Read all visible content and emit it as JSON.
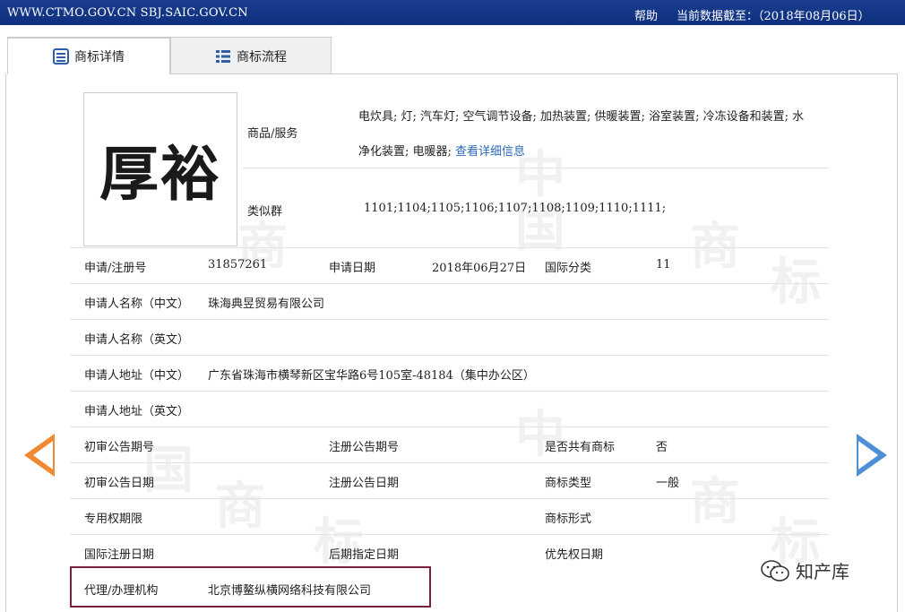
{
  "topbar": {
    "site": "WWW.CTMO.GOV.CN SBJ.SAIC.GOV.CN",
    "help": "帮助",
    "date": "当前数据截至：（2018年08月06日）"
  },
  "tabs": [
    {
      "label": "商标详情",
      "icon": "list-detail-icon"
    },
    {
      "label": "商标流程",
      "icon": "list-flow-icon"
    }
  ],
  "logo_text": "厚裕",
  "goods": {
    "label": "商品/服务",
    "line1": "电炊具; 灯; 汽车灯; 空气调节设备; 加热装置; 供暖装置; 浴室装置; 冷冻设备和装置; 水",
    "line2": "净化装置; 电暖器;",
    "link": "查看详细信息"
  },
  "similar": {
    "label": "类似群",
    "value": "1101;1104;1105;1106;1107;1108;1109;1110;1111;"
  },
  "row_reg": {
    "reg_label": "申请/注册号",
    "reg_value": "31857261",
    "date_label": "申请日期",
    "date_value": "2018年06月27日",
    "class_label": "国际分类",
    "class_value": "11"
  },
  "applicant_cn": {
    "label": "申请人名称（中文）",
    "value": "珠海典昱贸易有限公司"
  },
  "applicant_en": {
    "label": "申请人名称（英文）",
    "value": ""
  },
  "address_cn": {
    "label": "申请人地址（中文）",
    "value": "广东省珠海市横琴新区宝华路6号105室-48184（集中办公区）"
  },
  "address_en": {
    "label": "申请人地址（英文）",
    "value": ""
  },
  "row_pub": {
    "a": "初审公告期号",
    "b": "注册公告期号",
    "c": "是否共有商标",
    "c_value": "否"
  },
  "row_pubdate": {
    "a": "初审公告日期",
    "b": "注册公告日期",
    "c": "商标类型",
    "c_value": "一般"
  },
  "row_right": {
    "a": "专用权期限",
    "c": "商标形式"
  },
  "row_intl": {
    "a": "国际注册日期",
    "b": "后期指定日期",
    "c": "优先权日期"
  },
  "agent": {
    "label": "代理/办理机构",
    "value": "北京博鳌纵横网络科技有限公司"
  },
  "wechat": "知产库",
  "colors": {
    "topbar": "#0d2f7d",
    "left_arrow": "#f08a32",
    "right_arrow": "#4c8fd6",
    "highlight_box": "#7a2040",
    "link": "#2a6ab8"
  }
}
